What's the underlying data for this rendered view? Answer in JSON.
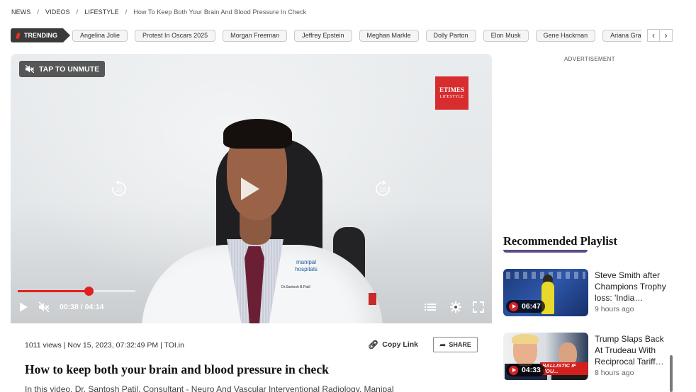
{
  "breadcrumb": {
    "items": [
      "NEWS",
      "VIDEOS",
      "LIFESTYLE"
    ],
    "separator": "/",
    "current": "How To Keep Both Your Brain And Blood Pressure In Check"
  },
  "trending": {
    "label": "TRENDING",
    "chips": [
      "Angelina Jolie",
      "Protest In Oscars 2025",
      "Morgan Freeman",
      "Jeffrey Epstein",
      "Meghan Markle",
      "Dolly Parton",
      "Elon Musk",
      "Gene Hackman",
      "Ariana Grande"
    ],
    "prev_icon": "‹",
    "next_icon": "›"
  },
  "player": {
    "unmute_label": "TAP TO UNMUTE",
    "brand_line1": "ETIMES",
    "brand_line2": "LIFESTYLE",
    "rewind_label": "10",
    "forward_label": "10",
    "current_time": "00:38",
    "duration": "04:14",
    "time_display": "00:38 / 04:14",
    "progress_fraction": 0.6,
    "hospital_logo": "manipal hospitals",
    "name_tag": "Dr.Santosh B.Patil",
    "accent_color": "#e02020"
  },
  "video_info": {
    "meta": "1011 views | Nov 15, 2023, 07:32:49 PM | TOI.in",
    "copy_link_label": "Copy Link",
    "share_label": "SHARE",
    "title": "How to keep both your brain and blood pressure in check",
    "description": "In this video, Dr. Santosh Patil, Consultant - Neuro And Vascular Interventional Radiology, Manipal"
  },
  "sidebar": {
    "advertisement_label": "ADVERTISEMENT",
    "playlist_title": "Recommended Playlist",
    "items": [
      {
        "title": "Steve Smith after Champions Trophy loss: 'India…",
        "duration": "06:47",
        "age": "9 hours ago"
      },
      {
        "title": "Trump Slaps Back At Trudeau With Reciprocal Tariff…",
        "duration": "04:33",
        "age": "8 hours ago",
        "thumb_caption": "BALLISTIC IF YOU..."
      }
    ]
  }
}
